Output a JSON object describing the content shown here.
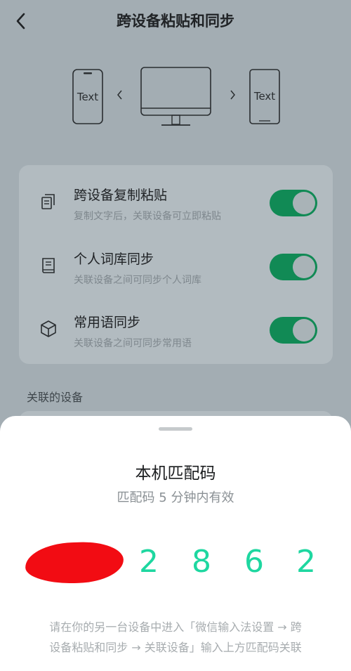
{
  "header": {
    "title": "跨设备粘贴和同步"
  },
  "illustration": {
    "phone_left_text": "Text",
    "phone_right_text": "Text"
  },
  "settings": [
    {
      "icon": "copy-paste-icon",
      "title": "跨设备复制粘贴",
      "desc": "复制文字后，关联设备可立即粘贴",
      "enabled": true
    },
    {
      "icon": "book-icon",
      "title": "个人词库同步",
      "desc": "关联设备之间可同步个人词库",
      "enabled": true
    },
    {
      "icon": "cube-icon",
      "title": "常用语同步",
      "desc": "关联设备之间可同步常用语",
      "enabled": true
    }
  ],
  "linked_devices_label": "关联的设备",
  "sheet": {
    "title": "本机匹配码",
    "subtitle": "匹配码 5 分钟内有效",
    "digits": [
      "2",
      "8",
      "6",
      "2"
    ],
    "footer_line1": "请在你的另一台设备中进入「微信输入法设置 → 跨",
    "footer_line2": "设备粘贴和同步 → 关联设备」输入上方匹配码关联"
  },
  "colors": {
    "toggle_on": "#118a55",
    "code_digit": "#1ed7a0",
    "redaction": "#f20c13"
  }
}
